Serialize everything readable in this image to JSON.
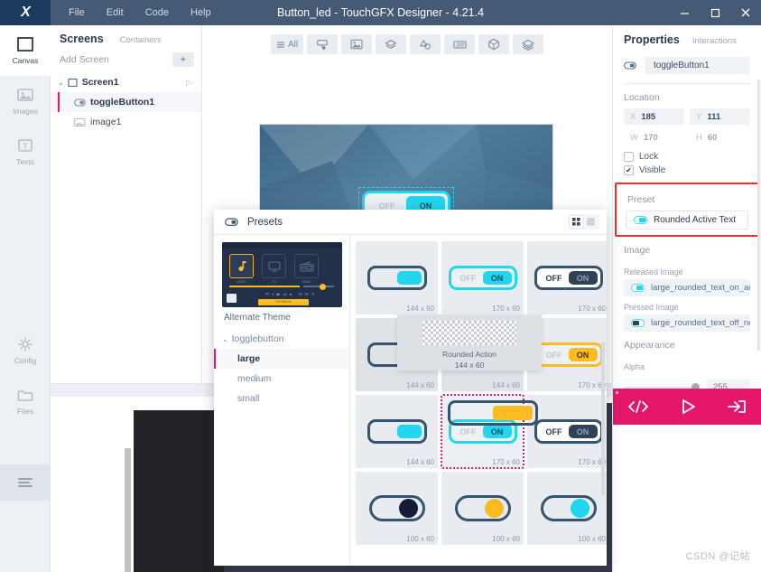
{
  "titlebar": {
    "logo": "X",
    "menu": [
      "File",
      "Edit",
      "Code",
      "Help"
    ],
    "title": "Button_led - TouchGFX Designer - 4.21.4",
    "minimize": "–",
    "maximize": "☐",
    "close": "✕"
  },
  "rail": {
    "items": [
      {
        "label": "Canvas",
        "icon": "square-icon"
      },
      {
        "label": "Images",
        "icon": "image-icon"
      },
      {
        "label": "Texts",
        "icon": "text-icon"
      },
      {
        "label": "Config",
        "icon": "gear-icon"
      },
      {
        "label": "Files",
        "icon": "folder-icon"
      }
    ],
    "hamburger": "hamburger-icon"
  },
  "screens": {
    "tab_active": "Screens",
    "tab_inactive": "Containers",
    "add_screen": "Add Screen",
    "add_button": "+",
    "tree": [
      {
        "label": "Screen1",
        "icon": "screen-icon",
        "caret": "⌄",
        "bold": false,
        "child": false,
        "selected": false,
        "play": "▷"
      },
      {
        "label": "toggleButton1",
        "icon": "toggle-icon",
        "bold": true,
        "child": true,
        "selected": true
      },
      {
        "label": "image1",
        "icon": "image-icon",
        "bold": false,
        "child": true,
        "selected": false
      }
    ]
  },
  "canvas": {
    "toolbar": [
      {
        "name": "filter-all-button",
        "label": "All",
        "icon": "list-icon"
      },
      {
        "name": "interaction-button",
        "label": "",
        "icon": "touch-icon"
      },
      {
        "name": "image-button",
        "label": "",
        "icon": "picture-icon"
      },
      {
        "name": "layers-button",
        "label": "",
        "icon": "layers-icon"
      },
      {
        "name": "shape-button",
        "label": "",
        "icon": "shape-icon"
      },
      {
        "name": "texture-button",
        "label": "",
        "icon": "texture-icon"
      },
      {
        "name": "box3d-button",
        "label": "",
        "icon": "cube-icon"
      },
      {
        "name": "stack-button",
        "label": "",
        "icon": "stack-icon"
      }
    ],
    "toggle_off": "OFF",
    "toggle_on": "ON"
  },
  "properties": {
    "tab_active": "Properties",
    "tab_inactive": "Interactions",
    "widget_name": "toggleButton1",
    "location_title": "Location",
    "x_key": "X",
    "x_val": "185",
    "y_key": "Y",
    "y_val": "111",
    "w_key": "W",
    "w_val": "170",
    "h_key": "H",
    "h_val": "60",
    "lock_label": "Lock",
    "visible_label": "Visible",
    "visible_mark": "✔",
    "preset_title": "Preset",
    "preset_value": "Rounded Active Text",
    "image_title": "Image",
    "released_label": "Released Image",
    "released_value": "large_rounded_text_on_active...",
    "pressed_label": "Pressed Image",
    "pressed_value": "large_rounded_text_off_norm...",
    "appearance_title": "Appearance",
    "alpha_label": "Alpha",
    "alpha_value": "255",
    "actions": [
      {
        "name": "generate-code-button",
        "glyph": "</>"
      },
      {
        "name": "run-simulator-button",
        "glyph": "▷"
      },
      {
        "name": "run-target-button",
        "glyph": "→]"
      }
    ]
  },
  "dialog": {
    "title": "Presets",
    "icon": "toggle-icon",
    "view_grid": "grid-view-icon",
    "view_list": "list-view-icon",
    "theme_name": "Alternate Theme",
    "theme_tiles": [
      {
        "caption": "MUSIC",
        "selected": true
      },
      {
        "caption": "TV",
        "selected": false
      },
      {
        "caption": "RADIO",
        "selected": false
      }
    ],
    "theme_button": "GO BACK",
    "tree": [
      {
        "label": "togglebutton",
        "caret": "⌄",
        "indent": false,
        "selected": false
      },
      {
        "label": "large",
        "indent": true,
        "selected": true
      },
      {
        "label": "medium",
        "indent": true,
        "selected": false
      },
      {
        "label": "small",
        "indent": true,
        "selected": false
      }
    ],
    "tooltip": {
      "name": "Rounded Action",
      "size": "144 x 60"
    },
    "colors": {
      "cyan": "#22d6f0",
      "amber": "#fbbb21",
      "dark": "#2f4257",
      "navy": "#141d35",
      "outline": "#37546e",
      "off_text": "#b9c6d2"
    },
    "off_label": "OFF",
    "on_label": "ON",
    "presets": [
      {
        "style": "rect",
        "knob": "#22d6f0",
        "size": "144 x 60",
        "state": "normal"
      },
      {
        "style": "txt",
        "knob": "#22d6f0",
        "ontext": "#0e4f5c",
        "border": "#22d6f0",
        "size": "170 x 60",
        "state": "normal"
      },
      {
        "style": "txt",
        "knob": "#2f4257",
        "ontext": "#8f9fb1",
        "border": "#37546e",
        "size": "170 x 60",
        "state": "normal"
      },
      {
        "style": "rect",
        "knob": "#fbbb21",
        "size": "144 x 60",
        "state": "hovered"
      },
      {
        "style": "rect",
        "knob": "#fbbb21",
        "size": "144 x 60",
        "state": "normal"
      },
      {
        "style": "txt",
        "knob": "#fbbb21",
        "ontext": "#6d4c05",
        "border": "#fbbb21",
        "size": "170 x 60",
        "state": "normal"
      },
      {
        "style": "rect",
        "knob": "#22d6f0",
        "size": "144 x 60",
        "state": "normal"
      },
      {
        "style": "txt",
        "knob": "#22d6f0",
        "ontext": "#0e4f5c",
        "border": "#22d6f0",
        "size": "170 x 60",
        "state": "picked"
      },
      {
        "style": "txt",
        "knob": "#2f4257",
        "ontext": "#8f9fb1",
        "border": "#37546e",
        "size": "170 x 60",
        "state": "normal"
      },
      {
        "style": "pill",
        "knob": "#141d35",
        "size": "100 x 60",
        "state": "normal"
      },
      {
        "style": "pill",
        "knob": "#fbbb21",
        "size": "100 x 60",
        "state": "normal"
      },
      {
        "style": "pill",
        "knob": "#22d6f0",
        "size": "100 x 60",
        "state": "normal"
      }
    ]
  },
  "watermark": "CSDN @记帖"
}
